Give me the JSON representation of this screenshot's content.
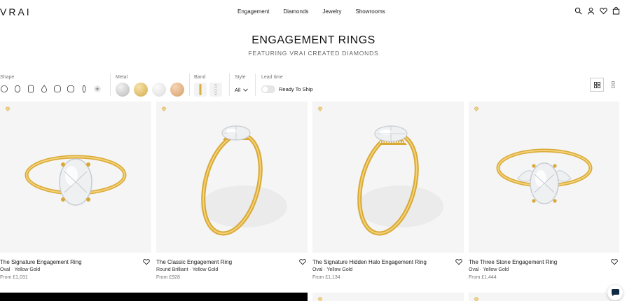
{
  "brand": {
    "logo": "VRAI"
  },
  "nav": [
    "Engagement",
    "Diamonds",
    "Jewelry",
    "Showrooms"
  ],
  "header_icons": [
    "search-icon",
    "user-icon",
    "heart-icon",
    "bag-icon"
  ],
  "page": {
    "title": "ENGAGEMENT RINGS",
    "subtitle": "FEATURING VRAI CREATED DIAMONDS"
  },
  "filters": {
    "shape_label": "Shape",
    "shapes": [
      "round",
      "oval",
      "emerald",
      "pear",
      "cushion",
      "radiant",
      "marquise",
      "more"
    ],
    "metal_label": "Metal",
    "metals": [
      {
        "name": "platinum",
        "color": "#c9c9c9"
      },
      {
        "name": "yellow-gold",
        "color": "#e5c472"
      },
      {
        "name": "white-gold",
        "color": "#e8e8e8"
      },
      {
        "name": "rose-gold",
        "color": "#e6b98e"
      }
    ],
    "band_label": "Band",
    "style_label": "Style",
    "style_value": "All",
    "lead_label": "Lead time",
    "lead_toggle": "Ready To Ship"
  },
  "products": [
    {
      "name": "The Signature Engagement Ring",
      "sub": "Oval · Yellow Gold",
      "price": "From £1,031"
    },
    {
      "name": "The Classic Engagement Ring",
      "sub": "Round Brilliant · Yellow Gold",
      "price": "From £928"
    },
    {
      "name": "The Signature Hidden Halo Engagement Ring",
      "sub": "Oval · Yellow Gold",
      "price": "From £1,134"
    },
    {
      "name": "The Three Stone Engagement Ring",
      "sub": "Oval · Yellow Gold",
      "price": "From £1,444"
    }
  ],
  "colors": {
    "gold": "#e2b23a",
    "gold_dark": "#b88a1e",
    "card_bg": "#f5f5f5"
  }
}
